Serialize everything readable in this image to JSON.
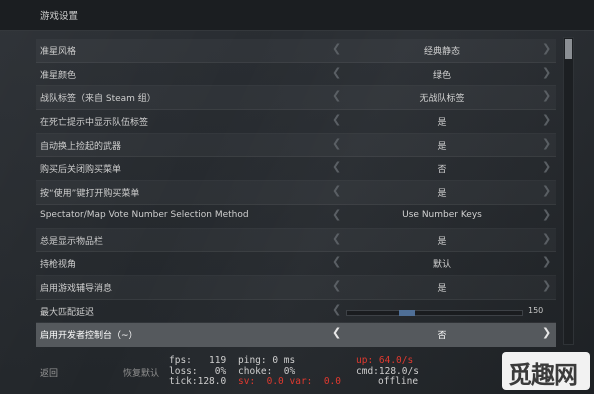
{
  "header": {
    "title": "游戏设置"
  },
  "settings": [
    {
      "label": "准星风格",
      "value": "经典静态"
    },
    {
      "label": "准星颜色",
      "value": "绿色"
    },
    {
      "label": "战队标签（来自 Steam 组）",
      "value": "无战队标签"
    },
    {
      "label": "在死亡提示中显示队伍标签",
      "value": "是"
    },
    {
      "label": "自动换上捡起的武器",
      "value": "是"
    },
    {
      "label": "购买后关闭购买菜单",
      "value": "否"
    },
    {
      "label": "按“使用”键打开购买菜单",
      "value": "是"
    },
    {
      "label": "Spectator/Map Vote Number Selection Method",
      "value": "Use Number Keys"
    },
    {
      "label": "总是显示物品栏",
      "value": "是"
    },
    {
      "label": "持枪视角",
      "value": "默认"
    },
    {
      "label": "启用游戏辅导消息",
      "value": "是"
    },
    {
      "label": "最大匹配延迟",
      "value": "150",
      "slider_fraction": 0.33
    },
    {
      "label": "启用开发者控制台（~）",
      "value": "否",
      "selected": true
    }
  ],
  "footer": {
    "back_label": "返回",
    "restore_label": "恢复默认"
  },
  "netgraph": {
    "col1": [
      "fps:   119",
      "loss:   0%",
      "tick:128.0"
    ],
    "col2": [
      "ping: 0 ms",
      "choke:  0%"
    ],
    "col2_line3_sv": "sv:  0.0",
    "col2_line3_var": "var:  0.0",
    "col3_up": "up: 64.0/s",
    "col3": [
      "cmd:128.0/s",
      "offline"
    ]
  },
  "watermark": {
    "text": "觅趣网"
  },
  "colors": {
    "selected_row": "#55595d",
    "slider_thumb": "#4f6f97",
    "netgraph_warn": "#e0392f"
  }
}
